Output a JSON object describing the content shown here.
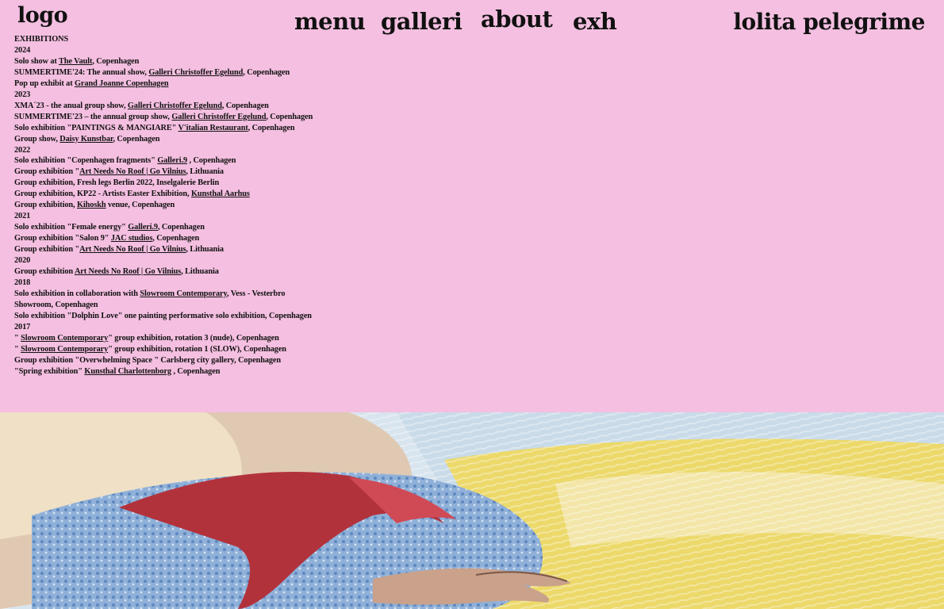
{
  "header": {
    "logo": "logo",
    "nav": {
      "menu": "menu",
      "galleri": "galleri",
      "about": "about",
      "exh": "exh"
    },
    "artist_name": "lolita pelegrime"
  },
  "exhibitions": {
    "heading": "EXHIBITIONS",
    "lines": [
      {
        "parts": [
          {
            "t": "2024"
          }
        ]
      },
      {
        "parts": [
          {
            "t": "Solo show at "
          },
          {
            "t": "The Vault",
            "link": true
          },
          {
            "t": ", Copenhagen"
          }
        ]
      },
      {
        "parts": [
          {
            "t": "SUMMERTIME'24: The annual show, "
          },
          {
            "t": "Galleri Christoffer Egelund",
            "link": true
          },
          {
            "t": ", Copenhagen"
          }
        ]
      },
      {
        "parts": [
          {
            "t": "Pop up exhibit at "
          },
          {
            "t": "Grand Joanne Copenhagen",
            "link": true
          }
        ]
      },
      {
        "parts": [
          {
            "t": "2023"
          }
        ]
      },
      {
        "parts": [
          {
            "t": "XMA´23 - the anual group show, "
          },
          {
            "t": "Galleri Christoffer Egelund",
            "link": true
          },
          {
            "t": ", Copenhagen"
          }
        ]
      },
      {
        "wrap": true,
        "parts": [
          {
            "t": "SUMMERTIME'23 – the annual group show, "
          },
          {
            "t": "Galleri Christoffer Egelund",
            "link": true
          },
          {
            "t": ", Copenhagen"
          }
        ]
      },
      {
        "parts": [
          {
            "t": "Solo exhibition \"PAINTINGS & MANGIARE\" "
          },
          {
            "t": "V'italian Restaurant",
            "link": true
          },
          {
            "t": ",  Copenhagen"
          }
        ]
      },
      {
        "parts": [
          {
            "t": "Group show, "
          },
          {
            "t": "Daisy Kunstbar",
            "link": true
          },
          {
            "t": ", Copenhagen"
          }
        ]
      },
      {
        "parts": [
          {
            "t": "2022"
          }
        ]
      },
      {
        "parts": [
          {
            "t": "Solo exhibition \"Copenhagen fragments\" "
          },
          {
            "t": "Galleri.9",
            "link": true
          },
          {
            "t": " , Copenhagen"
          }
        ]
      },
      {
        "parts": [
          {
            "t": "Group exhibition \""
          },
          {
            "t": "Art Needs No Roof | Go Vilnius",
            "link": true
          },
          {
            "t": ", Lithuania"
          }
        ]
      },
      {
        "parts": [
          {
            "t": "Group exhibition, Fresh legs Berlin 2022, Inselgalerie Berlin"
          }
        ]
      },
      {
        "parts": [
          {
            "t": "Group exhibition, KP22 - Artists Easter Exhibition, "
          },
          {
            "t": "Kunsthal Aarhus",
            "link": true
          }
        ]
      },
      {
        "parts": [
          {
            "t": "Group exhibition, "
          },
          {
            "t": "Kihoskh",
            "link": true
          },
          {
            "t": " venue, Copenhagen"
          }
        ]
      },
      {
        "parts": [
          {
            "t": " 2021"
          }
        ]
      },
      {
        "parts": [
          {
            "t": "Solo exhibition \"Female energy\" "
          },
          {
            "t": "Galleri.9",
            "link": true
          },
          {
            "t": ", Copenhagen"
          }
        ]
      },
      {
        "parts": [
          {
            "t": "Group exhibition \"Salon 9\" "
          },
          {
            "t": "JAC studios",
            "link": true
          },
          {
            "t": ", Copenhagen"
          }
        ]
      },
      {
        "parts": [
          {
            "t": "Group exhibition \""
          },
          {
            "t": "Art Needs No Roof | Go Vilnius",
            "link": true
          },
          {
            "t": ", Lithuania"
          }
        ]
      },
      {
        "parts": [
          {
            "t": "2020"
          }
        ]
      },
      {
        "parts": [
          {
            "t": "Group exhibition "
          },
          {
            "t": "Art Needs No Roof | Go Vilnius",
            "link": true
          },
          {
            "t": ", Lithuania"
          }
        ]
      },
      {
        "parts": [
          {
            "t": "2018"
          }
        ]
      },
      {
        "wrap": true,
        "parts": [
          {
            "t": "Solo exhibition in collaboration with "
          },
          {
            "t": "Slowroom Contemporary",
            "link": true
          },
          {
            "t": ", Vess - Vesterbro Showroom, Copenhagen"
          }
        ]
      },
      {
        "wrap": true,
        "parts": [
          {
            "t": "Solo exhibition \"Dolphin Love\" one painting performative solo exhibition, Copenhagen"
          }
        ]
      },
      {
        "parts": [
          {
            "t": "2017"
          }
        ]
      },
      {
        "parts": [
          {
            "t": "\" "
          },
          {
            "t": "Slowroom Contemporary",
            "link": true
          },
          {
            "t": "\" group exhibition, rotation 3 (nude), Copenhagen"
          }
        ]
      },
      {
        "parts": [
          {
            "t": "\" "
          },
          {
            "t": "Slowroom Contemporary",
            "link": true
          },
          {
            "t": "\" group exhibition, rotation 1 (SLOW), Copenhagen"
          }
        ]
      },
      {
        "parts": [
          {
            "t": "Group exhibition \"Overwhelming Space \" Carlsberg city gallery, Copenhagen"
          }
        ]
      },
      {
        "parts": [
          {
            "t": "\"Spring exhibition\" "
          },
          {
            "t": "Kunsthal Charlottenborg",
            "link": true
          },
          {
            "t": " , Copenhagen"
          }
        ]
      }
    ]
  },
  "colors": {
    "background": "#f4bfe0",
    "text": "#111111"
  },
  "icons": {
    "painting": "painting-image"
  }
}
